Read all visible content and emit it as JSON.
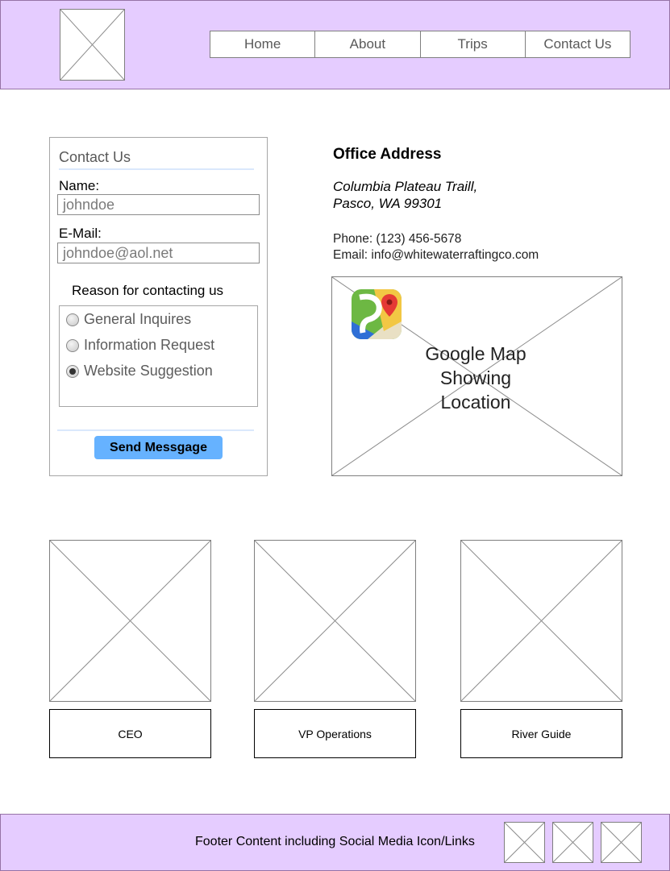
{
  "header": {
    "logo_icon": "image-placeholder-icon",
    "nav": [
      "Home",
      "About",
      "Trips",
      "Contact Us"
    ]
  },
  "form": {
    "title": "Contact Us",
    "name_label": "Name:",
    "name_value": "johndoe",
    "email_label": "E-Mail:",
    "email_value": "johndoe@aol.net",
    "reason_label": "Reason for contacting us",
    "reasons": [
      {
        "label": "General Inquires",
        "checked": false
      },
      {
        "label": "Information Request",
        "checked": false
      },
      {
        "label": "Website Suggestion",
        "checked": true
      }
    ],
    "submit_label": "Send Messgage"
  },
  "office": {
    "title": "Office Address",
    "address_line1": "Columbia Plateau Traill,",
    "address_line2": "Pasco, WA 99301",
    "phone": "Phone: (123) 456-5678",
    "email": "Email: info@whitewaterraftingco.com",
    "map_text_line1": "Google Map",
    "map_text_line2": "Showing",
    "map_text_line3": "Location",
    "map_icon": "google-maps-icon"
  },
  "team": [
    {
      "role": "CEO"
    },
    {
      "role": "VP Operations"
    },
    {
      "role": "River Guide"
    }
  ],
  "footer": {
    "text": "Footer Content including Social Media Icon/Links",
    "social_icons": [
      "image-placeholder-icon",
      "image-placeholder-icon",
      "image-placeholder-icon"
    ]
  },
  "colors": {
    "header_bg": "#e5ccff",
    "header_border": "#9673a6",
    "button_bg": "#66b2ff",
    "divider": "#dae8fc"
  }
}
